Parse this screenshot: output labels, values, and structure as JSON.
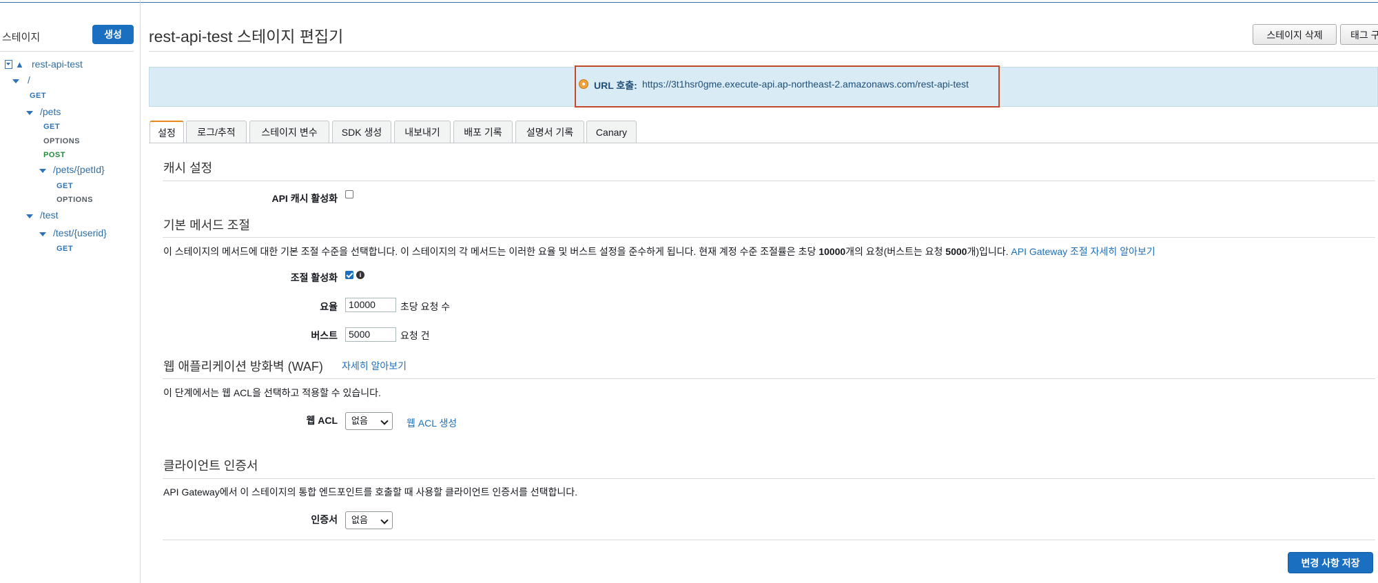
{
  "sidebar": {
    "heading": "스테이지",
    "create_label": "생성",
    "tree": {
      "stage": "rest-api-test",
      "root_path": "/",
      "root_get": "GET",
      "pets": "/pets",
      "pets_get": "GET",
      "pets_options": "OPTIONS",
      "pets_post": "POST",
      "pets_petid": "/pets/{petId}",
      "petid_get": "GET",
      "petid_options": "OPTIONS",
      "test": "/test",
      "test_userid": "/test/{userid}",
      "userid_get": "GET"
    }
  },
  "header": {
    "title": "rest-api-test 스테이지 편집기",
    "delete_stage_label": "스테이지 삭제",
    "tags_label": "태그 구"
  },
  "invoke": {
    "label": "URL 호출:",
    "url": "https://3t1hsr0gme.execute-api.ap-northeast-2.amazonaws.com/rest-api-test"
  },
  "tabs": [
    "설정",
    "로그/추적",
    "스테이지 변수",
    "SDK 생성",
    "내보내기",
    "배포 기록",
    "설명서 기록",
    "Canary"
  ],
  "cache": {
    "title": "캐시 설정",
    "enable_label": "API 캐시 활성화",
    "enabled": false
  },
  "throttling": {
    "title": "기본 메서드 조절",
    "desc_part1": "이 스테이지의 메서드에 대한 기본 조절 수준을 선택합니다. 이 스테이지의 각 메서드는 이러한 요율 및 버스트 설정을 준수하게 됩니다. 현재 계정 수준 조절률은 초당 ",
    "desc_rate": "10000",
    "desc_part2": "개의 요청(버스트는 요청 ",
    "desc_burst": "5000",
    "desc_part3": "개)입니다. ",
    "desc_link": "API Gateway 조절 자세히 알아보기",
    "enable_label": "조절 활성화",
    "enabled": true,
    "info_icon": "info-icon",
    "rate_label": "요율",
    "rate_value": "10000",
    "rate_unit": "초당 요청 수",
    "burst_label": "버스트",
    "burst_value": "5000",
    "burst_unit": "요청 건"
  },
  "waf": {
    "title": "웹 애플리케이션 방화벽 (WAF)",
    "learn_more": "자세히 알아보기",
    "desc": "이 단계에서는 웹 ACL을 선택하고 적용할 수 있습니다.",
    "acl_label": "웹 ACL",
    "acl_value": "없음",
    "create_acl": "웹 ACL 생성"
  },
  "client_cert": {
    "title": "클라이언트 인증서",
    "desc": "API Gateway에서 이 스테이지의 통합 엔드포인트를 호출할 때 사용할 클라이언트 인증서를 선택합니다.",
    "cert_label": "인증서",
    "cert_value": "없음"
  },
  "save_label": "변경 사항 저장",
  "colors": {
    "primary": "#1a6fc0",
    "link": "#1f6fb8",
    "info_bar": "#d9ecf5",
    "highlight_border": "#c0492b",
    "tab_accent": "#e88a1a"
  }
}
